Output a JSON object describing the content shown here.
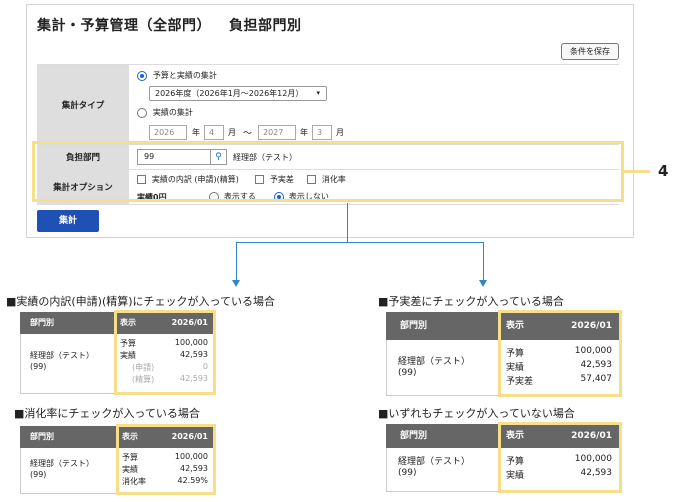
{
  "header": {
    "title": "集計・予算管理（全部門）",
    "subtitle": "負担部門別",
    "save_button": "条件を保存"
  },
  "form": {
    "agg_type_label": "集計タイプ",
    "option_budget_actual": "予算と実績の集計",
    "fiscal_select": "2026年度（2026年1月〜2026年12月）",
    "option_actual": "実績の集計",
    "from_year": "2026",
    "from_month": "4",
    "to_year": "2027",
    "to_month": "3",
    "year_unit": "年",
    "month_unit": "月",
    "tilde": "〜",
    "dept_label": "負担部門",
    "dept_code": "99",
    "dept_name": "経理部（テスト）",
    "options_label": "集計オプション",
    "chk_breakdown": "実績の内訳 (申請)(精算)",
    "chk_variance": "予実差",
    "chk_rate": "消化率",
    "zero_label": "実績0円",
    "zero_show": "表示する",
    "zero_hide": "表示しない",
    "run_button": "集計"
  },
  "callout": {
    "number": "4"
  },
  "captions": {
    "breakdown": "■実績の内訳(申請)(精算)にチェックが入っている場合",
    "variance": "■予実差にチェックが入っている場合",
    "rate": "■消化率にチェックが入っている場合",
    "none": "■いずれもチェックが入っていない場合"
  },
  "tables": {
    "col_dept": "部門別",
    "col_show": "表示",
    "col_period": "2026/01",
    "dept_name": "経理部（テスト）",
    "dept_code": "(99)",
    "label_budget": "予算",
    "label_actual": "実績",
    "label_applied": "(申請)",
    "label_settled": "(精算)",
    "label_variance": "予実差",
    "label_rate": "消化率",
    "budget": "100,000",
    "actual": "42,593",
    "applied": "0",
    "settled": "42,593",
    "variance": "57,407",
    "rate": "42.59%"
  }
}
